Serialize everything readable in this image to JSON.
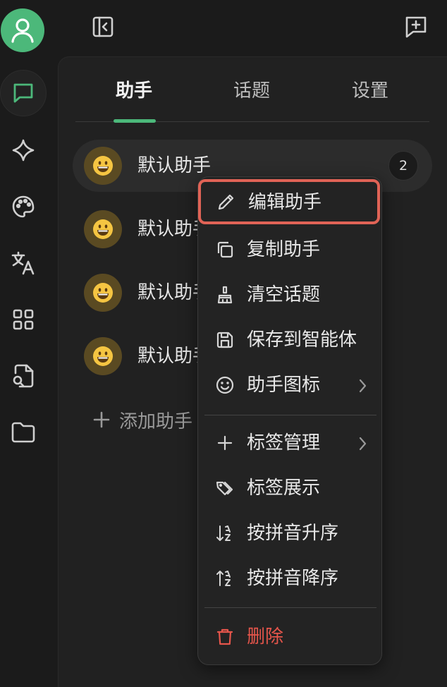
{
  "tabs": [
    {
      "label": "助手"
    },
    {
      "label": "话题"
    },
    {
      "label": "设置"
    }
  ],
  "assistants": [
    {
      "name": "默认助手",
      "count": "2"
    },
    {
      "name": "默认助手"
    },
    {
      "name": "默认助手"
    },
    {
      "name": "默认助手"
    }
  ],
  "add_assistant_label": "添加助手",
  "menu": {
    "edit": "编辑助手",
    "copy": "复制助手",
    "clear_topics": "清空话题",
    "save_agent": "保存到智能体",
    "assistant_icon": "助手图标",
    "tag_manage": "标签管理",
    "tag_display": "标签展示",
    "sort_pinyin_asc": "按拼音升序",
    "sort_pinyin_desc": "按拼音降序",
    "delete": "删除"
  },
  "colors": {
    "accent": "#4cb87a",
    "danger": "#e5554b",
    "highlight_border": "#e06356"
  },
  "icons": {
    "user": "user-icon",
    "chat": "chat-icon",
    "sparkle": "sparkle-icon",
    "palette": "palette-icon",
    "translate": "translate-icon",
    "apps": "apps-grid-icon",
    "doc_search": "document-search-icon",
    "folder": "folder-icon",
    "sidebar_toggle": "sidebar-collapse-icon",
    "new_chat": "new-chat-icon"
  }
}
